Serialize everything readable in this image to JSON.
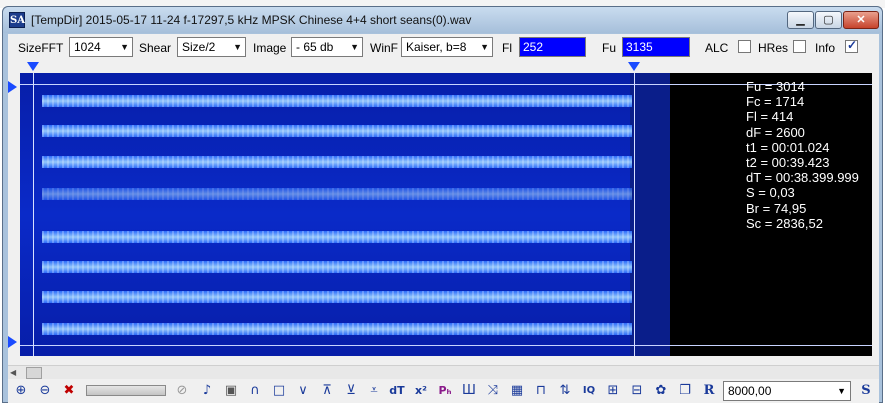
{
  "window": {
    "app_icon": "SA",
    "title": "[TempDir] 2015-05-17 11-24 f-17297,5 kHz MPSK Chinese 4+4 short seans(0).wav"
  },
  "toolbar": {
    "sizefft_label": "SizeFFT",
    "sizefft_value": "1024",
    "shear_label": "Shear",
    "shear_value": "Size/2",
    "image_label": "Image",
    "image_value": "- 65 db",
    "winf_label": "WinF",
    "winf_value": "Kaiser, b=8",
    "fl_label": "Fl",
    "fl_value": "252",
    "fu_label": "Fu",
    "fu_value": "3135",
    "alc_label": "ALC",
    "alc_checked": false,
    "hres_label": "HRes",
    "hres_checked": false,
    "info_label": "Info",
    "info_checked": true
  },
  "info": [
    "Fu = 3014",
    "Fc = 1714",
    "Fl = 414",
    "dF = 2600",
    "t1 = 00:01.024",
    "t2 = 00:39.423",
    "dT = 00:38.399.999",
    "S = 0,03",
    "Br = 74,95",
    "Sc = 2836,52"
  ],
  "bottom": {
    "freq_value": "8000,00",
    "tool_icons": [
      "zoom-in-icon",
      "zoom-out-icon",
      "clear-icon",
      "stop-icon",
      "speaker-icon",
      "frame-icon",
      "arc-icon",
      "rect-icon",
      "v-shape-icon",
      "marker-down-icon",
      "marker-down-filled-icon",
      "marker-double-icon",
      "dt-icon",
      "x-squared-icon",
      "p-h-icon",
      "comb-icon",
      "cross-icon",
      "grid-icon",
      "pulse-icon",
      "sort-icon",
      "iq-icon",
      "pattern-a-icon",
      "pattern-b-icon",
      "gear-icon",
      "copy-icon",
      "r-icon",
      "s-icon"
    ]
  },
  "colors": {
    "field_input_bg": "#0000ff",
    "spectrum_bg": "#000000",
    "signal": "#4aa0ff"
  }
}
